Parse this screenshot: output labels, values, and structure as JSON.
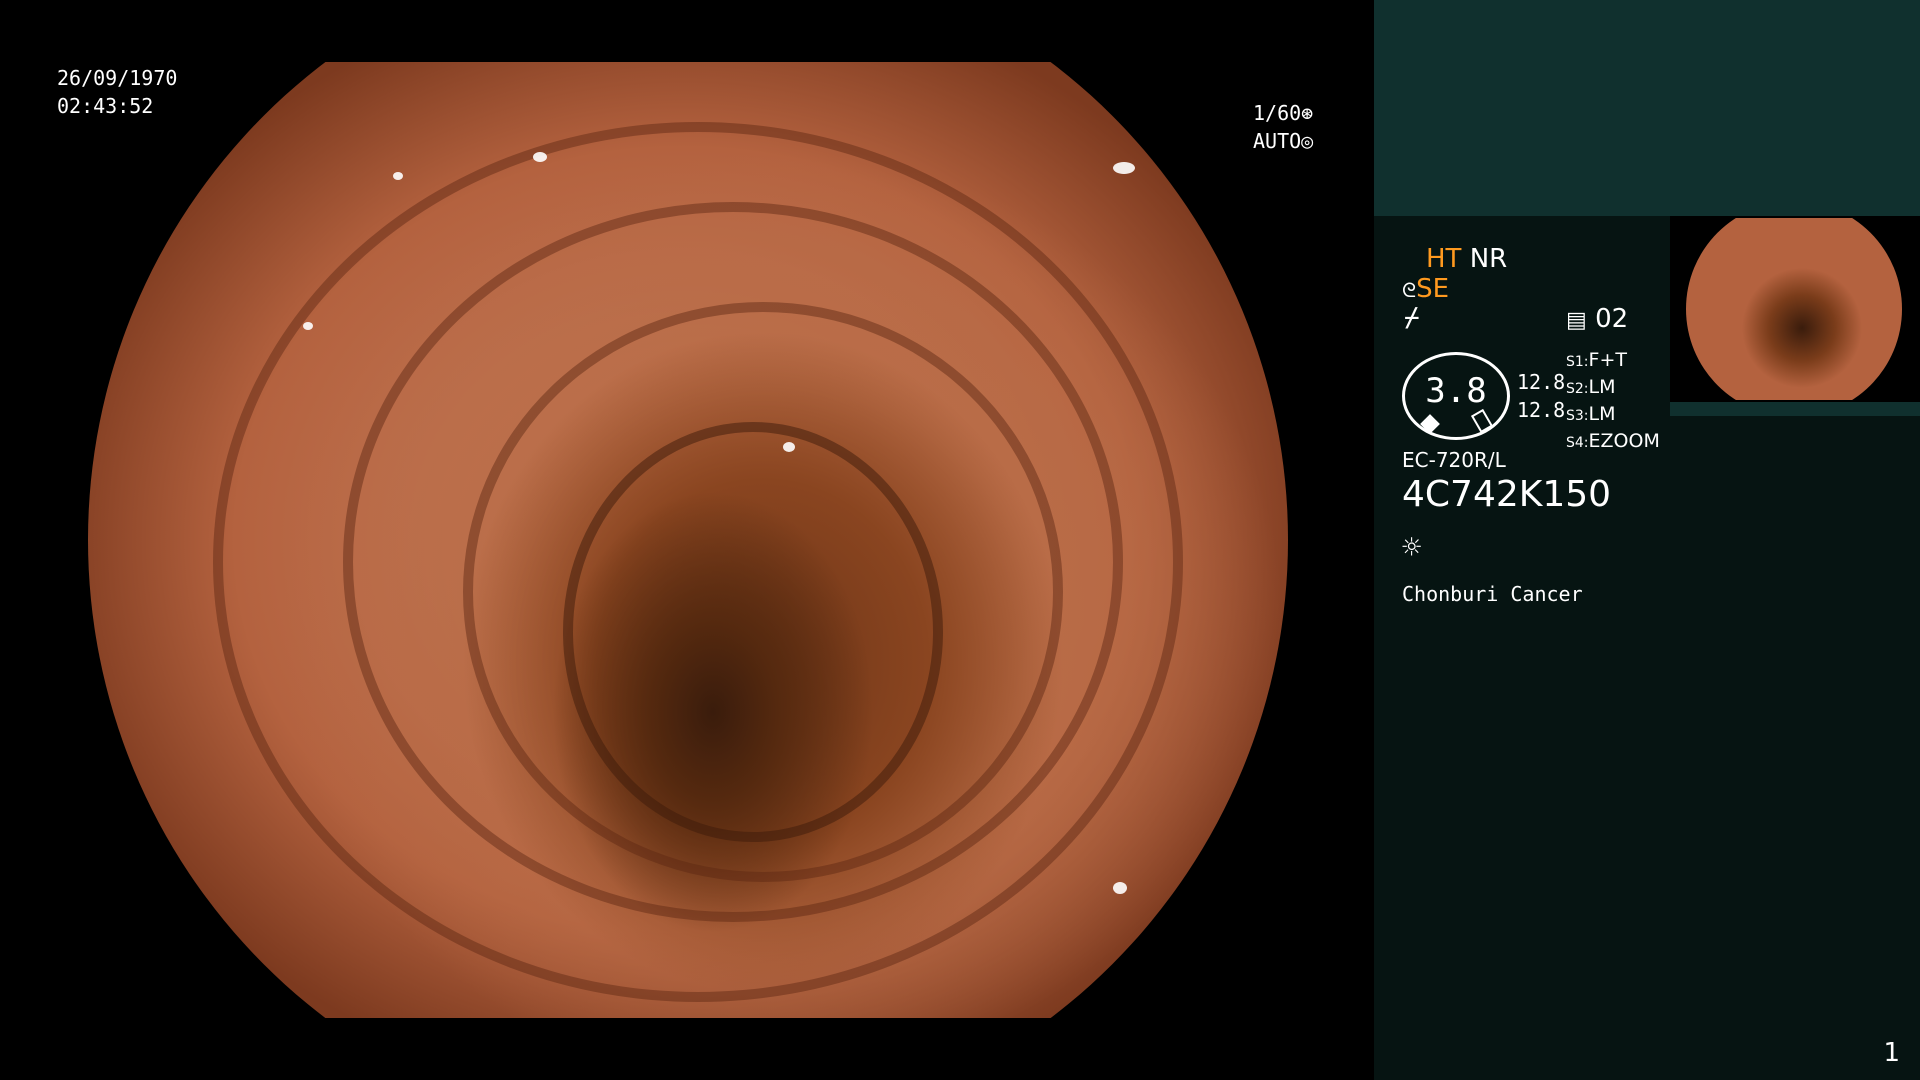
{
  "osd": {
    "date": "26/09/1970",
    "time": "02:43:52",
    "shutter": "1/60",
    "shutter_icon": "aperture-icon",
    "exposure": "AUTO",
    "exposure_icon": "iris-icon"
  },
  "panel": {
    "mode_ht": "HT",
    "mode_nr": "NR",
    "mode_se": "SE",
    "memo_label": "02",
    "gauge_value": "3.8",
    "gauge_small_1": "12.8",
    "gauge_small_2": "12.8",
    "settings": [
      {
        "key": "S1:",
        "value": "F+T"
      },
      {
        "key": "S2:",
        "value": "LM"
      },
      {
        "key": "S3:",
        "value": "LM"
      },
      {
        "key": "S4:",
        "value": "EZOOM"
      }
    ],
    "scope_model": "EC-720R/L",
    "scope_serial": "4C742K150",
    "facility": "Chonburi Cancer",
    "page_number": "1"
  },
  "colors": {
    "accent_orange": "#ff9a1f",
    "panel_bg": "#061412",
    "panel_top_bg": "#10302e"
  }
}
